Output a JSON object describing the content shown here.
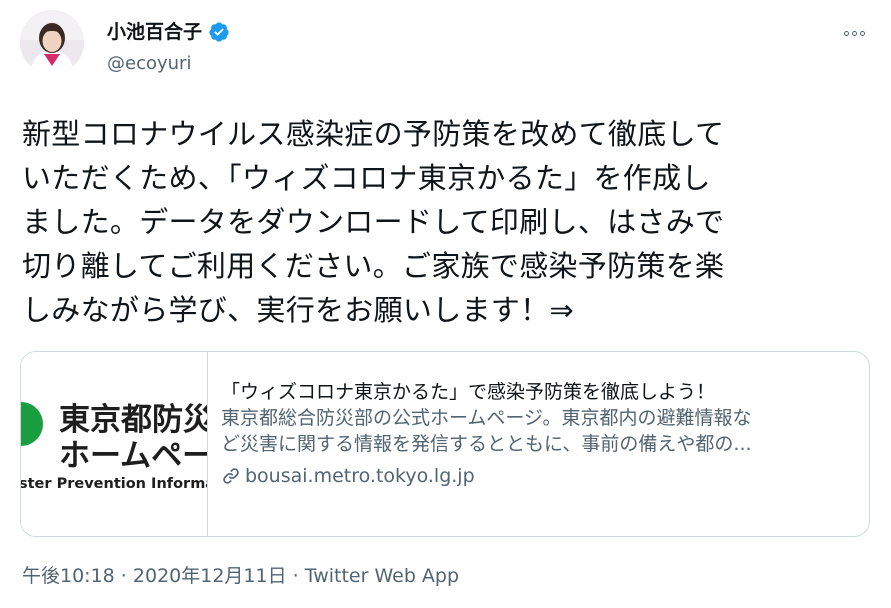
{
  "author": {
    "display_name": "小池百合子",
    "handle": "@ecoyuri",
    "verified": true,
    "avatar_icon": "avatar-photo"
  },
  "more_icon": "more-horizontal-icon",
  "tweet": {
    "lines": [
      "新型コロナウイルス感染症の予防策を改めて徹底して",
      "いただくため、「ウィズコロナ東京かるた」を作成し",
      "ました。データをダウンロードして印刷し、はさみで",
      "切り離してご利用ください。ご家族で感染予防策を楽",
      "しみながら学び、実行をお願いします！⇒"
    ]
  },
  "card": {
    "thumbnail": {
      "line1": "東京都防災",
      "line2": "ホームペー",
      "line3": "ster Prevention Informa",
      "accent_color": "#1a9e3f"
    },
    "title": "「ウィズコロナ東京かるた」で感染予防策を徹底しよう！",
    "description_lines": [
      "東京都総合防災部の公式ホームページ。東京都内の避難情報な",
      "ど災害に関する情報を発信するとともに、事前の備えや都の..."
    ],
    "domain": "bousai.metro.tokyo.lg.jp",
    "domain_icon": "link-icon"
  },
  "footer": {
    "time": "午後10:18",
    "separator1": " · ",
    "date": "2020年12月11日",
    "separator2": " · ",
    "source": "Twitter Web App"
  },
  "colors": {
    "text": "#0f1419",
    "secondary": "#536471",
    "border": "#cfd9de",
    "verified": "#1d9bf0"
  }
}
